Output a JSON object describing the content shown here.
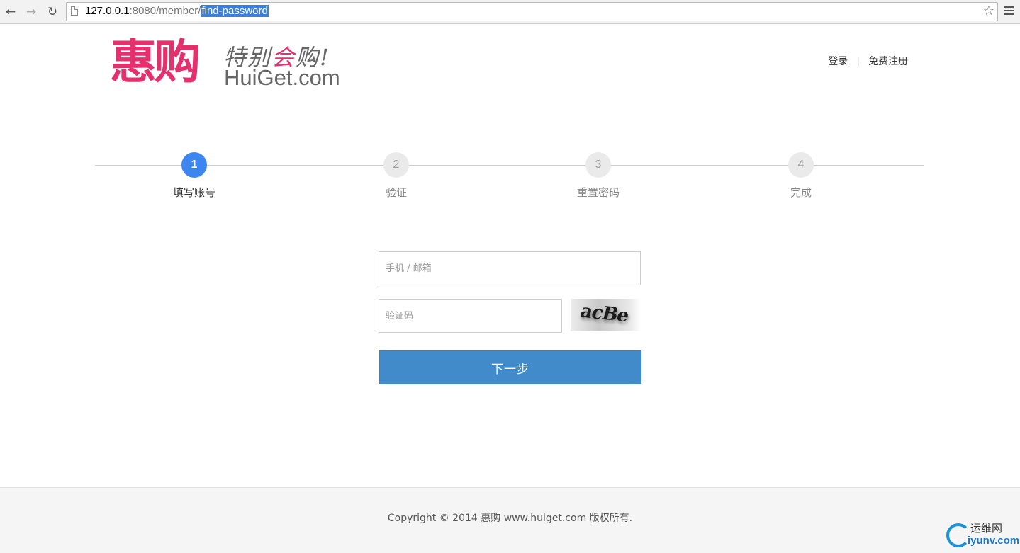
{
  "browser": {
    "url_host": "127.0.0.1",
    "url_port_path": ":8080/member/",
    "url_selected": "find-password"
  },
  "header": {
    "logo_cn": "惠购",
    "slogan_part1": "特别",
    "slogan_highlight": "会",
    "slogan_part2": "购!",
    "logo_domain": "HuiGet.com",
    "login_link": "登录",
    "divider": "|",
    "register_link": "免费注册"
  },
  "steps": [
    {
      "number": "1",
      "label": "填写账号",
      "active": true
    },
    {
      "number": "2",
      "label": "验证",
      "active": false
    },
    {
      "number": "3",
      "label": "重置密码",
      "active": false
    },
    {
      "number": "4",
      "label": "完成",
      "active": false
    }
  ],
  "form": {
    "account_placeholder": "手机 / 邮箱",
    "captcha_placeholder": "验证码",
    "captcha_text": "acBe",
    "next_button": "下一步"
  },
  "footer": {
    "copyright": "Copyright © 2014 惠购 www.huiget.com 版权所有."
  },
  "watermark": {
    "cn": "运维网",
    "en": "iyunv.com"
  },
  "colors": {
    "brand": "#e5306e",
    "primary_button": "#428bca",
    "active_step": "#3d86f0"
  }
}
